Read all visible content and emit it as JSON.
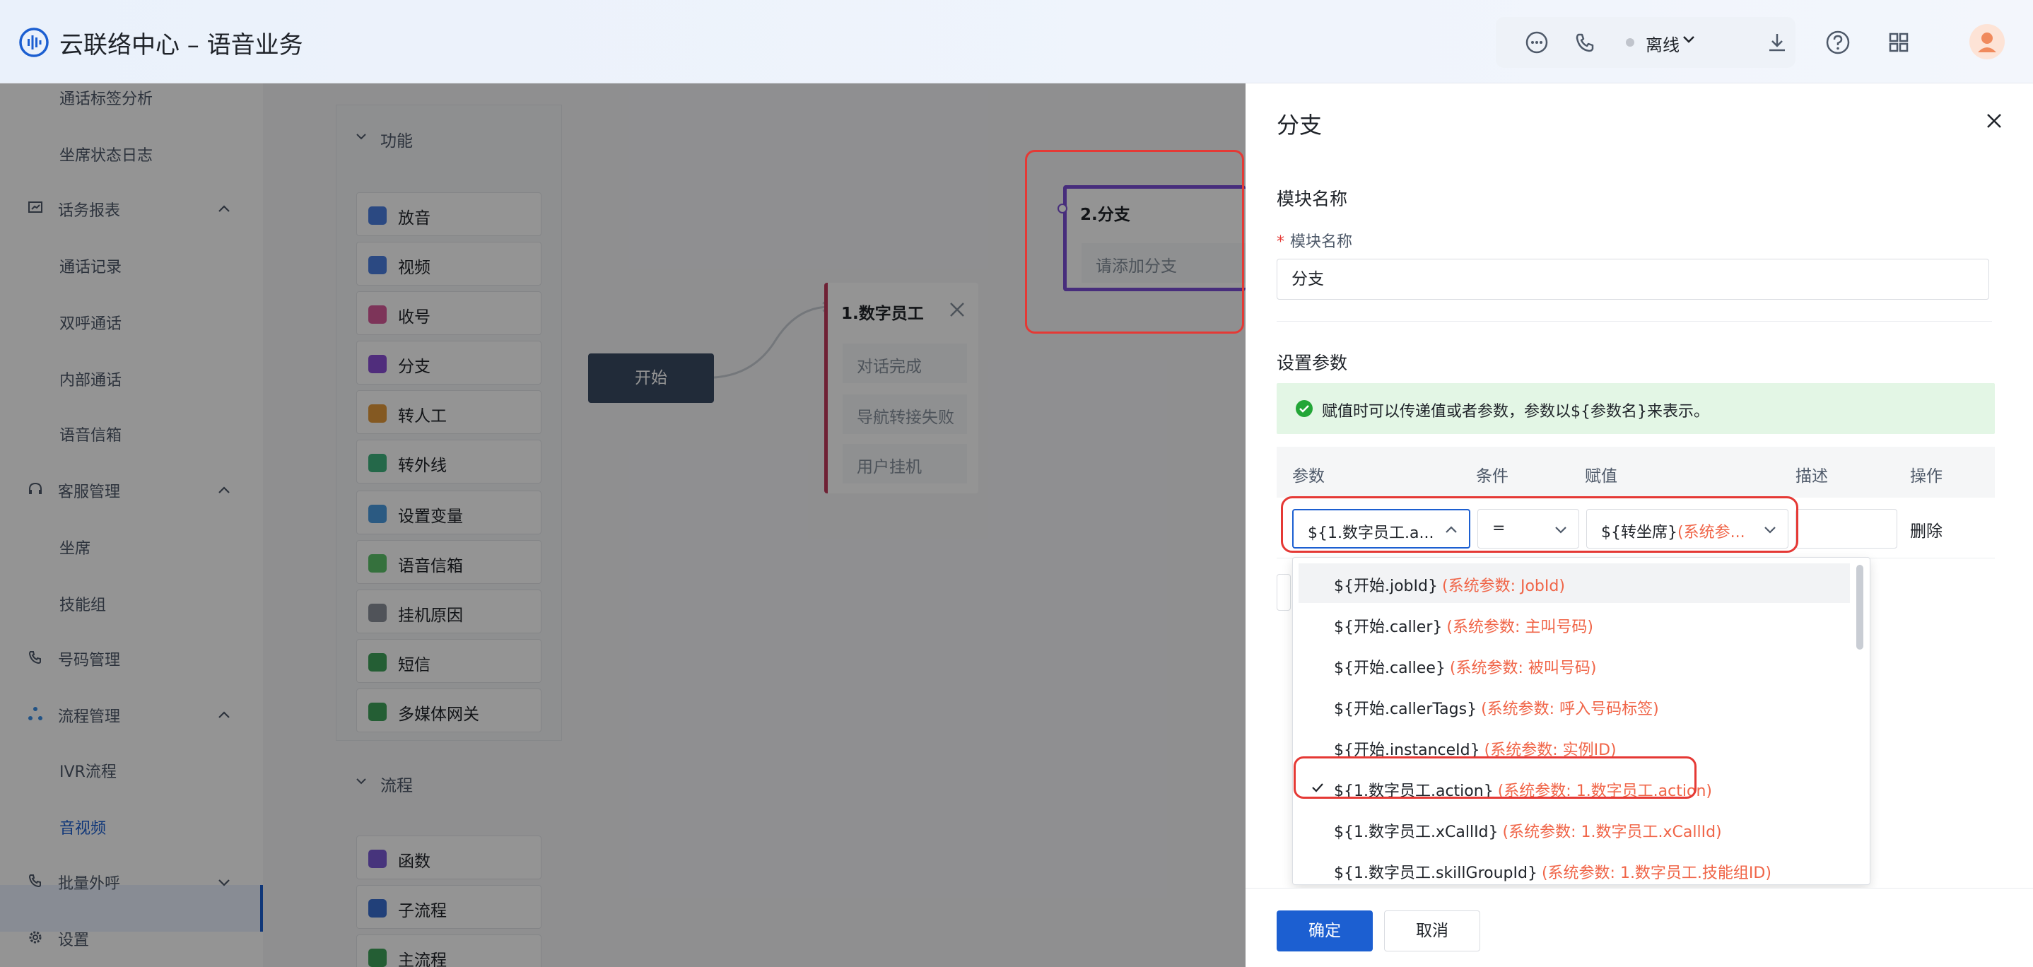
{
  "app": {
    "title": "云联络中心 – 语音业务"
  },
  "header": {
    "status": "离线",
    "icons": [
      "chat-bubble-icon",
      "phone-icon",
      "download-icon",
      "help-icon",
      "apps-grid-icon"
    ]
  },
  "sidebar": {
    "items": [
      {
        "label": "通话标签分析",
        "type": "item"
      },
      {
        "label": "坐席状态日志",
        "type": "item"
      },
      {
        "label": "话务报表",
        "type": "group"
      },
      {
        "label": "通话记录",
        "type": "item"
      },
      {
        "label": "双呼通话",
        "type": "item"
      },
      {
        "label": "内部通话",
        "type": "item"
      },
      {
        "label": "语音信箱",
        "type": "item"
      },
      {
        "label": "客服管理",
        "type": "group"
      },
      {
        "label": "坐席",
        "type": "item"
      },
      {
        "label": "技能组",
        "type": "item"
      },
      {
        "label": "号码管理",
        "type": "group"
      },
      {
        "label": "流程管理",
        "type": "group"
      },
      {
        "label": "IVR流程",
        "type": "item"
      },
      {
        "label": "音视频",
        "type": "item",
        "active": true
      },
      {
        "label": "批量外呼",
        "type": "group"
      },
      {
        "label": "设置",
        "type": "group"
      }
    ]
  },
  "canvas": {
    "function_section": "功能",
    "components": [
      {
        "label": "放音",
        "color": "#4a7fe0"
      },
      {
        "label": "视频",
        "color": "#4a7fe0"
      },
      {
        "label": "收号",
        "color": "#d85a9a"
      },
      {
        "label": "分支",
        "color": "#8a4fd6"
      },
      {
        "label": "转人工",
        "color": "#e39a3b"
      },
      {
        "label": "转外线",
        "color": "#3fb37f"
      },
      {
        "label": "设置变量",
        "color": "#4a9be0"
      },
      {
        "label": "语音信箱",
        "color": "#5cc36a"
      },
      {
        "label": "挂机原因",
        "color": "#8a8f99"
      },
      {
        "label": "短信",
        "color": "#3fa35a"
      },
      {
        "label": "多媒体网关",
        "color": "#3fa35a"
      }
    ],
    "flow_section": "流程",
    "flow_components": [
      {
        "label": "函数",
        "color": "#7a5ad6"
      },
      {
        "label": "子流程",
        "color": "#3a6fd0"
      },
      {
        "label": "主流程",
        "color": "#3fa35a"
      }
    ],
    "start_node": "开始",
    "node1": {
      "title": "1.数字员工",
      "rows": [
        "对话完成",
        "导航转接失败",
        "用户挂机"
      ]
    },
    "node2": {
      "title": "2.分支",
      "rows": [
        "请添加分支"
      ]
    }
  },
  "drawer": {
    "title": "分支",
    "module_section": "模块名称",
    "module_label": "模块名称",
    "module_value": "分支",
    "params_section": "设置参数",
    "alert": "赋值时可以传递值或者参数，参数以${参数名}来表示。",
    "table_headers": [
      "参数",
      "条件",
      "赋值",
      "描述",
      "操作"
    ],
    "row": {
      "param": "${1.数字员工.a...",
      "condition": "=",
      "value": "${转坐席}",
      "value_hint": "(系统参...",
      "delete": "删除"
    },
    "options": [
      {
        "text": "${开始.jobId}",
        "hint": "(系统参数: JobId)",
        "hover": true,
        "selected": false
      },
      {
        "text": "${开始.caller}",
        "hint": "(系统参数: 主叫号码)",
        "hover": false,
        "selected": false
      },
      {
        "text": "${开始.callee}",
        "hint": "(系统参数: 被叫号码)",
        "hover": false,
        "selected": false
      },
      {
        "text": "${开始.callerTags}",
        "hint": "(系统参数: 呼入号码标签)",
        "hover": false,
        "selected": false
      },
      {
        "text": "${开始.instanceId}",
        "hint": "(系统参数: 实例ID)",
        "hover": false,
        "selected": false
      },
      {
        "text": "${1.数字员工.action}",
        "hint": "(系统参数: 1.数字员工.action)",
        "hover": false,
        "selected": true
      },
      {
        "text": "${1.数字员工.xCallId}",
        "hint": "(系统参数: 1.数字员工.xCallId)",
        "hover": false,
        "selected": false
      },
      {
        "text": "${1.数字员工.skillGroupId}",
        "hint": "(系统参数: 1.数字员工.技能组ID)",
        "hover": false,
        "selected": false
      }
    ],
    "confirm": "确定",
    "cancel": "取消"
  }
}
